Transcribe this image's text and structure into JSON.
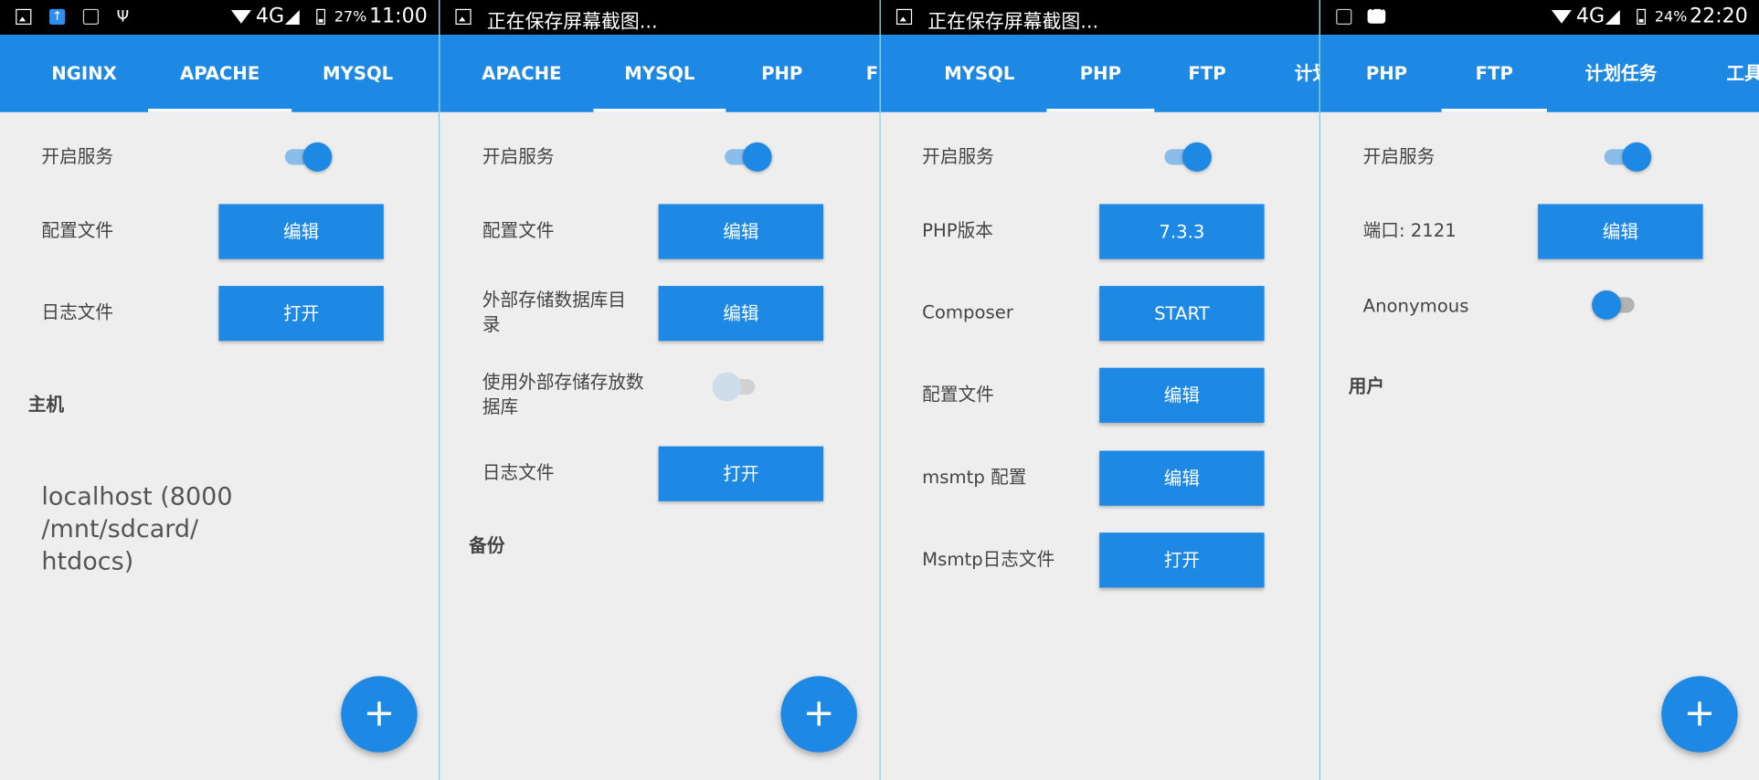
{
  "colors": {
    "accent": "#1e88e5",
    "statusbar": "#000000",
    "background": "#eeeeee",
    "divider": "#6fd3dc"
  },
  "screens": [
    {
      "status": {
        "icons": [
          "image-icon",
          "upload-icon",
          "camera-icon",
          "usb-icon",
          "wifi-icon",
          "signal-icon",
          "battery-icon"
        ],
        "network": "4G",
        "battery": "27%",
        "time": "11:00"
      },
      "tabs": [
        "NGINX",
        "APACHE",
        "MYSQL"
      ],
      "active_tab": "APACHE",
      "rows": {
        "enable_service": "开启服务",
        "config_file": "配置文件",
        "log_file": "日志文件"
      },
      "buttons": {
        "edit": "编辑",
        "open": "打开"
      },
      "section": "主机",
      "host": "localhost (8000 /mnt/sdcard/\nhtdocs)",
      "fab": "+"
    },
    {
      "status": {
        "icons": [
          "image-icon"
        ],
        "text": "正在保存屏幕截图..."
      },
      "tabs": [
        "APACHE",
        "MYSQL",
        "PHP",
        "F"
      ],
      "active_tab": "MYSQL",
      "rows": {
        "enable_service": "开启服务",
        "config_file": "配置文件",
        "external_db_dir": "外部存储数据库目\n录",
        "use_external_db": "使用外部存储存放数\n据库",
        "log_file": "日志文件"
      },
      "buttons": {
        "edit1": "编辑",
        "edit2": "编辑",
        "open": "打开"
      },
      "section": "备份",
      "fab": "+"
    },
    {
      "status": {
        "icons": [
          "image-icon"
        ],
        "text": "正在保存屏幕截图..."
      },
      "tabs": [
        "MYSQL",
        "PHP",
        "FTP",
        "计划"
      ],
      "active_tab": "PHP",
      "rows": {
        "enable_service": "开启服务",
        "php_version": "PHP版本",
        "composer": "Composer",
        "config_file": "配置文件",
        "msmtp_config": "msmtp 配置",
        "msmtp_log": "Msmtp日志文件"
      },
      "buttons": {
        "version": "7.3.3",
        "start": "START",
        "edit1": "编辑",
        "edit2": "编辑",
        "open": "打开"
      }
    },
    {
      "status": {
        "icons": [
          "camera-icon",
          "message-icon",
          "wifi-icon",
          "signal-icon",
          "battery-icon"
        ],
        "network": "4G",
        "battery": "24%",
        "time": "22:20"
      },
      "tabs": [
        "PHP",
        "FTP",
        "计划任务",
        "工具"
      ],
      "active_tab": "FTP",
      "rows": {
        "enable_service": "开启服务",
        "port": "端口: 2121",
        "anonymous": "Anonymous"
      },
      "buttons": {
        "edit": "编辑"
      },
      "section": "用户",
      "fab": "+"
    }
  ]
}
